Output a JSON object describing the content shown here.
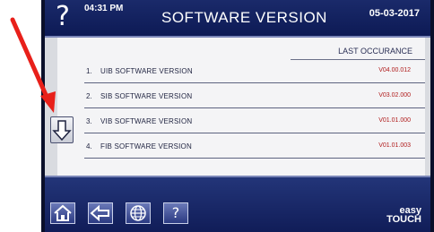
{
  "header": {
    "time": "04:31 PM",
    "title": "SOFTWARE VERSION",
    "date": "05-03-2017",
    "help_label": "?"
  },
  "table": {
    "column_header": "LAST OCCURANCE",
    "rows": [
      {
        "num": "1.",
        "label": "UIB SOFTWARE VERSION",
        "value": "V04.00.012"
      },
      {
        "num": "2.",
        "label": "SIB SOFTWARE VERSION",
        "value": "V03.02.000"
      },
      {
        "num": "3.",
        "label": "VIB SOFTWARE VERSION",
        "value": "V01.01.000"
      },
      {
        "num": "4.",
        "label": "FIB SOFTWARE VERSION",
        "value": "V01.01.003"
      }
    ]
  },
  "footer": {
    "help_label": "?",
    "brand_line1": "easy",
    "brand_line2": "TOUCH"
  },
  "annotation": {
    "arrow_color": "#e8201a"
  },
  "colors": {
    "header_bg": "#0d1a55",
    "value_red": "#b01c1c"
  },
  "icons": [
    "help-icon",
    "down-arrow-icon",
    "home-icon",
    "back-arrow-icon",
    "globe-icon"
  ]
}
